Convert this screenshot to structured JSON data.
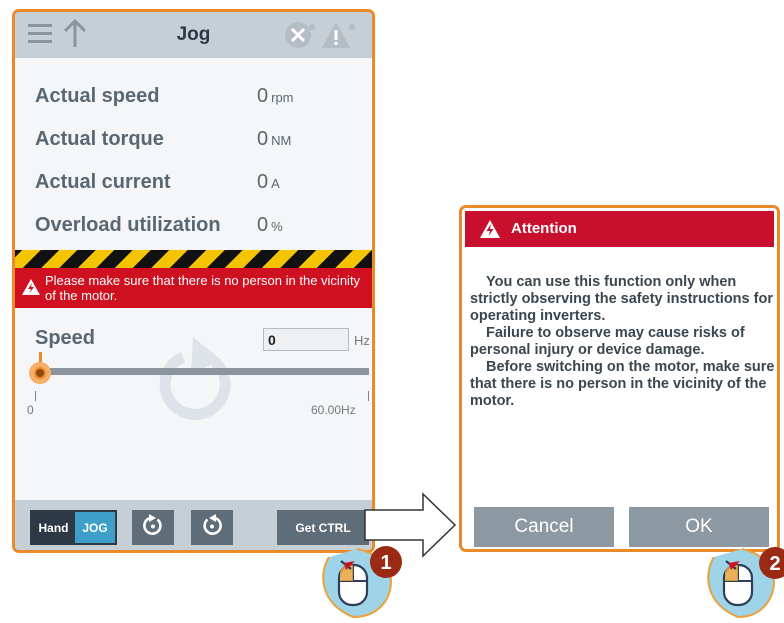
{
  "jog_screen": {
    "title": "Jog",
    "readouts": [
      {
        "label": "Actual speed",
        "value": "0",
        "unit": "rpm"
      },
      {
        "label": "Actual torque",
        "value": "0",
        "unit": "NM"
      },
      {
        "label": "Actual current",
        "value": "0",
        "unit": "A"
      },
      {
        "label": "Overload utilization",
        "value": "0",
        "unit": "%"
      }
    ],
    "warning_text": "Please make sure that there is no person in the vicinity of the motor.",
    "speed": {
      "label": "Speed",
      "value": "0",
      "unit": "Hz",
      "scale_min": "0",
      "scale_max": "60.00Hz",
      "slider_fraction": 0
    },
    "bottom": {
      "hand_label": "Hand",
      "jog_label": "JOG",
      "get_ctrl_label": "Get CTRL"
    }
  },
  "attention_dialog": {
    "title": "Attention",
    "paragraphs": [
      "You can use this function only when strictly observing the safety instructions for operating inverters.",
      "Failure to observe may cause risks of personal injury or device damage.",
      "Before switching on the motor, make sure that there is no person in the vicinity of the motor."
    ],
    "cancel_label": "Cancel",
    "ok_label": "OK"
  },
  "steps": {
    "step1": "1",
    "step2": "2"
  },
  "colors": {
    "accent_orange": "#ec8a2a",
    "alarm_red": "#cf1020",
    "header_gray": "#c6ced6",
    "button_dark": "#5f6d79",
    "jog_blue": "#3ea0c8",
    "step_badge": "#9b2a14"
  }
}
